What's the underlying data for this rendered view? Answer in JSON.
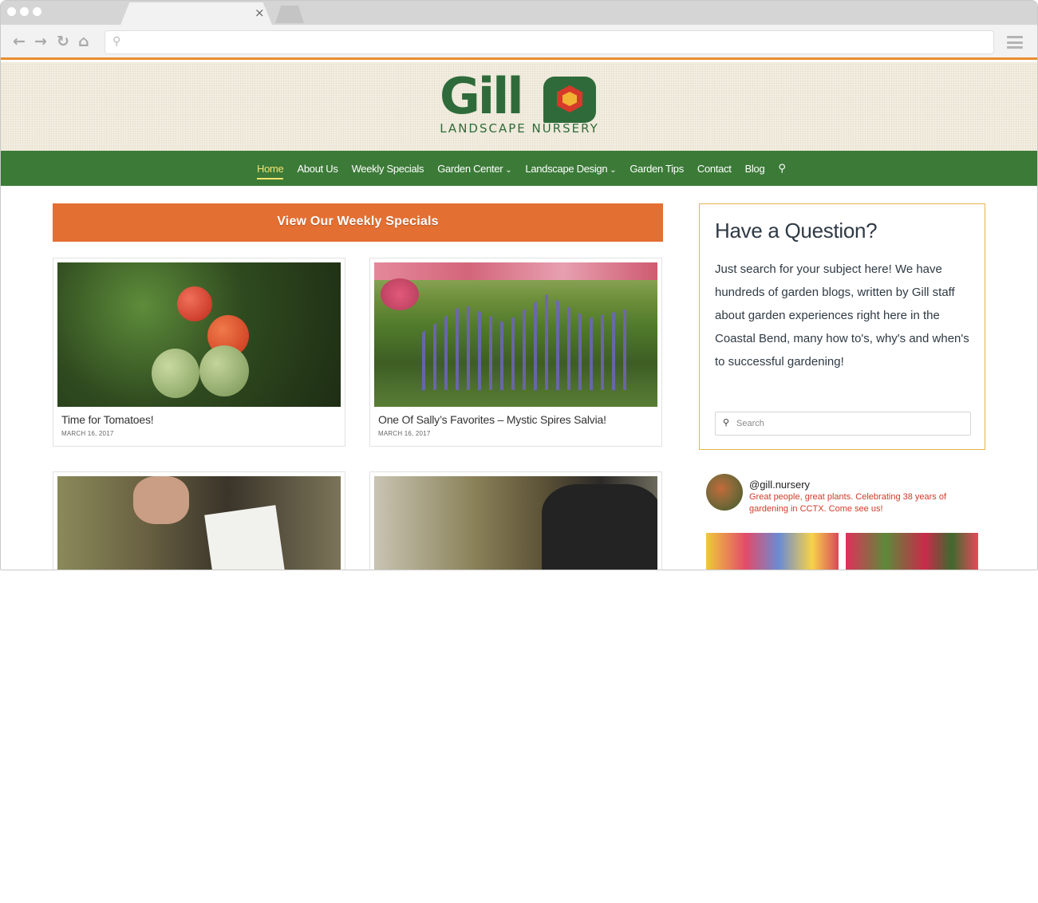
{
  "browser": {
    "tab_close": "×",
    "url": ""
  },
  "logo": {
    "word": "Gill",
    "subtitle": "LANDSCAPE NURSERY"
  },
  "nav": {
    "items": [
      {
        "label": "Home"
      },
      {
        "label": "About Us"
      },
      {
        "label": "Weekly Specials"
      },
      {
        "label": "Garden Center"
      },
      {
        "label": "Landscape Design"
      },
      {
        "label": "Garden Tips"
      },
      {
        "label": "Contact"
      },
      {
        "label": "Blog"
      }
    ]
  },
  "cta": {
    "label": "View Our Weekly Specials"
  },
  "posts": [
    {
      "title": "Time for Tomatoes!",
      "date": "MARCH 16, 2017"
    },
    {
      "title": "One Of Sally’s Favorites –  Mystic Spires Salvia!",
      "date": "MARCH 16, 2017"
    },
    {
      "title": "",
      "date": ""
    },
    {
      "title": "",
      "date": ""
    }
  ],
  "sidebar": {
    "heading": "Have a Question?",
    "body": "Just search for your subject here! We have hundreds of garden blogs, written by Gill staff about garden experiences right here in the Coastal Bend, many how to's, why's and when's to successful gardening!",
    "search_placeholder": "Search"
  },
  "instagram": {
    "handle": "@gill.nursery",
    "bio": "Great people, great plants. Celebrating 38 years of gardening in CCTX. Come see us!"
  }
}
